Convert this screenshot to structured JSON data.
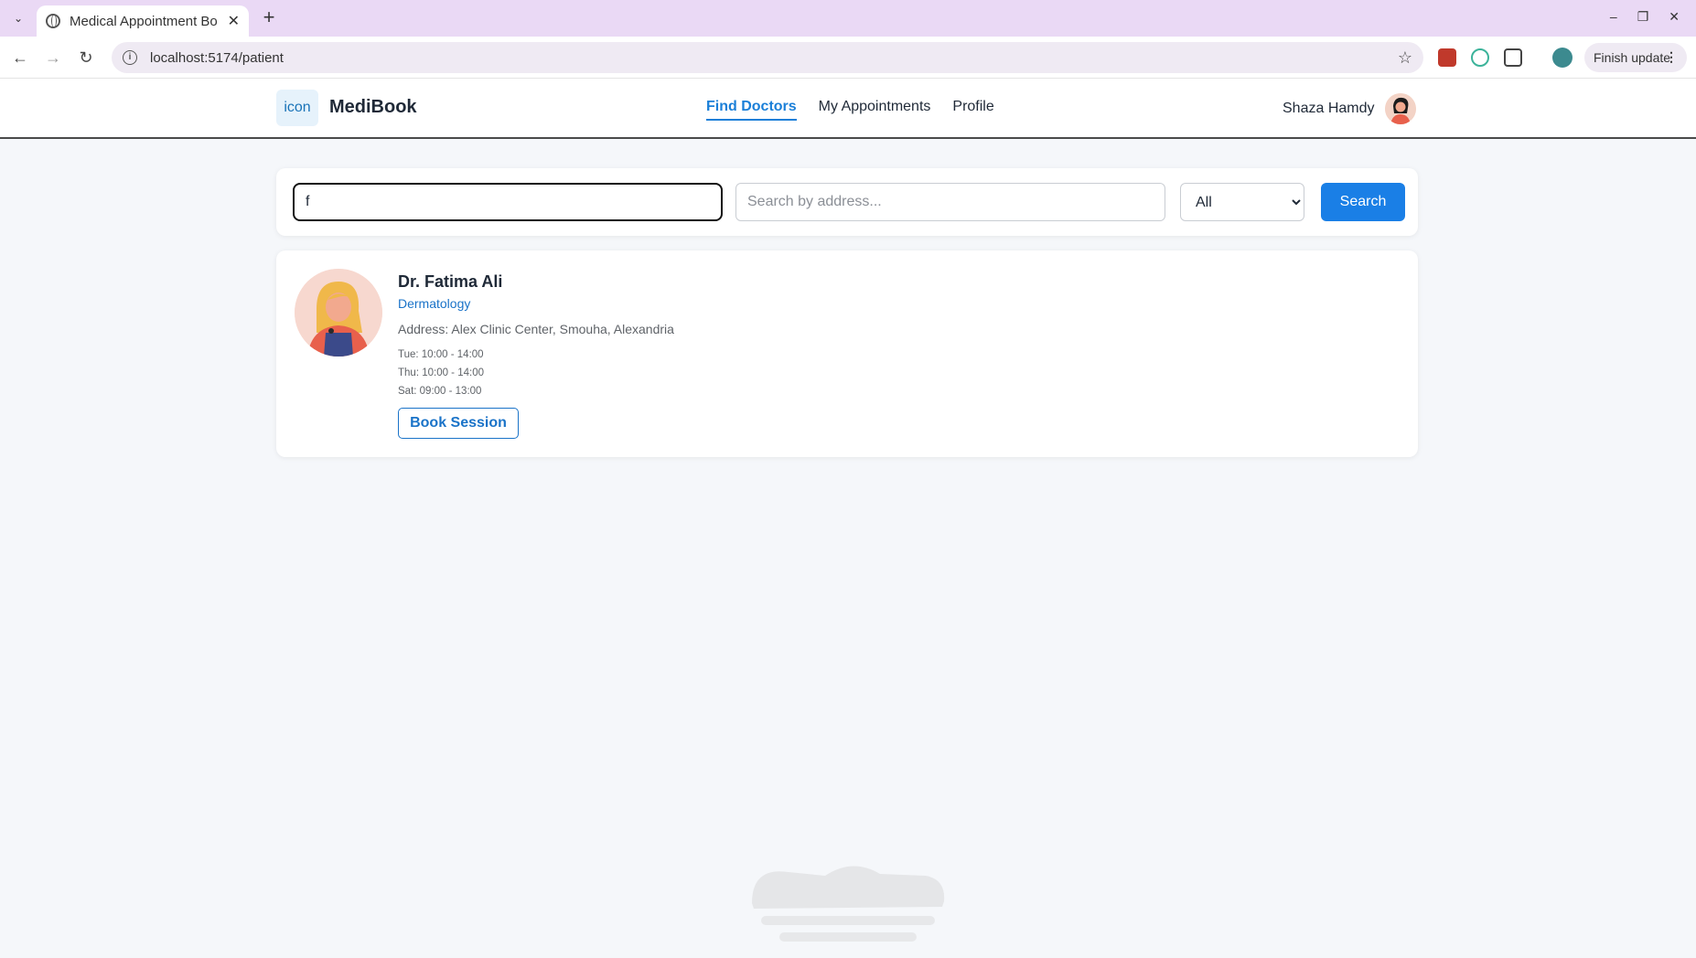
{
  "browser": {
    "tab_title": "Medical Appointment Bo",
    "url": "localhost:5174/patient",
    "update_label": "Finish update"
  },
  "app": {
    "logo_text": "icon",
    "brand": "MediBook",
    "nav": [
      "Find Doctors",
      "My Appointments",
      "Profile"
    ],
    "active_nav": "Find Doctors",
    "user_name": "Shaza Hamdy"
  },
  "search": {
    "name_value": "f",
    "address_placeholder": "Search by address...",
    "filter_selected": "All",
    "button_label": "Search"
  },
  "doctors": [
    {
      "name": "Dr. Fatima Ali",
      "specialty": "Dermatology",
      "address": "Address: Alex Clinic Center, Smouha, Alexandria",
      "hours": [
        "Tue: 10:00 - 14:00",
        "Thu: 10:00 - 14:00",
        "Sat: 09:00 - 13:00"
      ],
      "book_label": "Book Session"
    }
  ],
  "colors": {
    "accent": "#1a7fe6",
    "link": "#1a73c8",
    "browser_tabbar": "#ead9f5"
  }
}
